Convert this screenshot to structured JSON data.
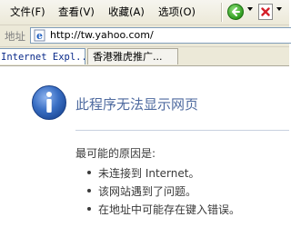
{
  "menu": {
    "items": [
      {
        "label": "文件(F)"
      },
      {
        "label": "查看(V)"
      },
      {
        "label": "收藏(A)"
      },
      {
        "label": "选项(O)"
      }
    ]
  },
  "toolbar": {
    "back_icon": "back-arrow-icon",
    "stop_icon": "stop-icon"
  },
  "address_bar": {
    "label": "地址",
    "url": "http://tw.yahoo.com/"
  },
  "tabs": [
    {
      "label": "Internet Expl..."
    },
    {
      "label": "香港雅虎推广..."
    }
  ],
  "error_page": {
    "title": "此程序无法显示网页",
    "reasons_heading": "最可能的原因是:",
    "reasons": [
      "未连接到 Internet。",
      "该网站遇到了问题。",
      "在地址中可能存在键入错误。"
    ]
  },
  "colors": {
    "title": "#4e6a9f",
    "info_icon": "#2b5fb0",
    "chrome": "#ece9d8"
  }
}
